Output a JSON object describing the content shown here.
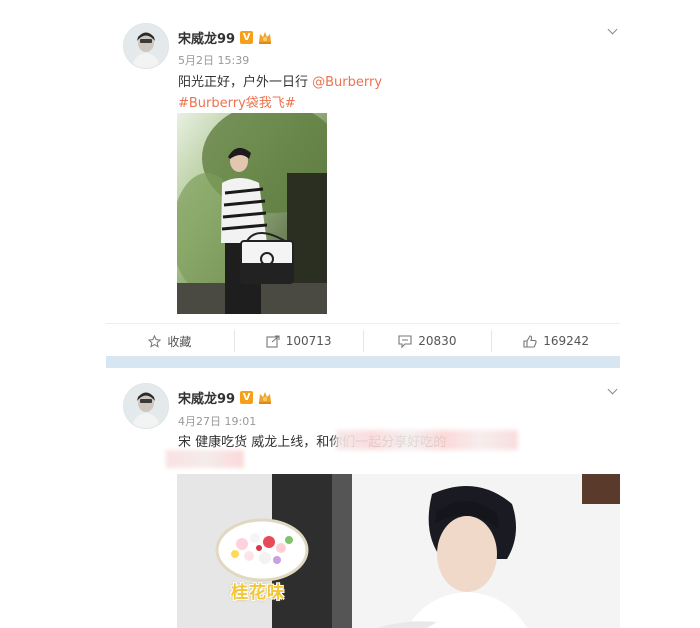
{
  "posts": [
    {
      "username": "宋威龙99",
      "verified_badge": "V",
      "time": "5月2日 15:39",
      "text_line1": "阳光正好，户外一日行 ",
      "mention": "@Burberry",
      "hashtag": "#Burberry袋我飞#",
      "actions": {
        "favorite_label": "收藏",
        "repost_count": "100713",
        "comment_count": "20830",
        "like_count": "169242"
      }
    },
    {
      "username": "宋威龙99",
      "verified_badge": "V",
      "time": "4月27日 19:01",
      "text_line1": "宋 健康吃货 威龙上线，和你们一起分享好吃的",
      "image_overlay_text": "桂花味"
    }
  ],
  "colors": {
    "link": "#eb7350",
    "verified": "#f6a019",
    "divider": "#d7e6f0"
  },
  "icons": [
    "star-icon",
    "repost-icon",
    "comment-icon",
    "like-icon",
    "verified-icon",
    "crown-icon",
    "chevron-down-icon"
  ]
}
